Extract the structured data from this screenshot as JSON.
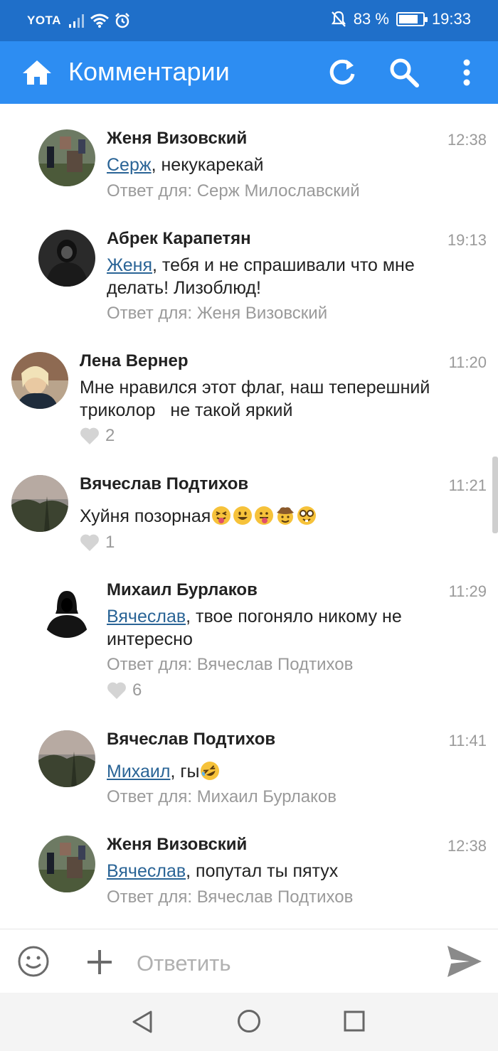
{
  "status_bar": {
    "carrier": "YOTA",
    "battery_percent": "83 %",
    "battery_level": 0.83,
    "time": "19:33"
  },
  "app_bar": {
    "title": "Комментарии",
    "icons": [
      "home-icon",
      "refresh-icon",
      "search-icon",
      "more-vert-icon"
    ],
    "color": "#2d8df2",
    "status_color": "#1f6fc9"
  },
  "comments": [
    {
      "author": "Женя Визовский",
      "time": "12:38",
      "mention": "Серж",
      "text": ", некукарекай",
      "reply_to": "Ответ для: Серж Милославский"
    },
    {
      "author": "Абрек Карапетян",
      "time": "19:13",
      "mention": "Женя",
      "text": ", тебя и не спрашивали что мне делать! Лизоблюд!",
      "reply_to": "Ответ для: Женя Визовский"
    },
    {
      "author": "Лена Вернер",
      "time": "11:20",
      "text": "Мне нравился этот флаг, наш теперешний триколор   не такой яркий",
      "likes": "2"
    },
    {
      "author": "Вячеслав Подтихов",
      "time": "11:21",
      "text": "Хуйня позорная",
      "emojis": [
        "squinting-tongue-emoji",
        "grinning-emoji",
        "tongue-emoji",
        "cowboy-emoji",
        "nerd-emoji"
      ],
      "likes": "1"
    },
    {
      "author": "Михаил Бурлаков",
      "time": "11:29",
      "mention": "Вячеслав",
      "text": ", твое погоняло никому не интересно",
      "reply_to": "Ответ для: Вячеслав Подтихов",
      "likes": "6"
    },
    {
      "author": "Вячеслав Подтихов",
      "time": "11:41",
      "mention": "Михаил",
      "text": ", гы",
      "emojis": [
        "rofl-emoji"
      ],
      "reply_to": "Ответ для: Михаил Бурлаков"
    },
    {
      "author": "Женя Визовский",
      "time": "12:38",
      "mention": "Вячеслав",
      "text": ", попутал ты пятух",
      "reply_to": "Ответ для: Вячеслав Подтихов"
    }
  ],
  "composer": {
    "placeholder": "Ответить",
    "icons": [
      "emoji-icon",
      "add-icon",
      "send-icon"
    ]
  },
  "nav": {
    "icons": [
      "back-icon",
      "home-circle-icon",
      "recents-icon"
    ]
  }
}
